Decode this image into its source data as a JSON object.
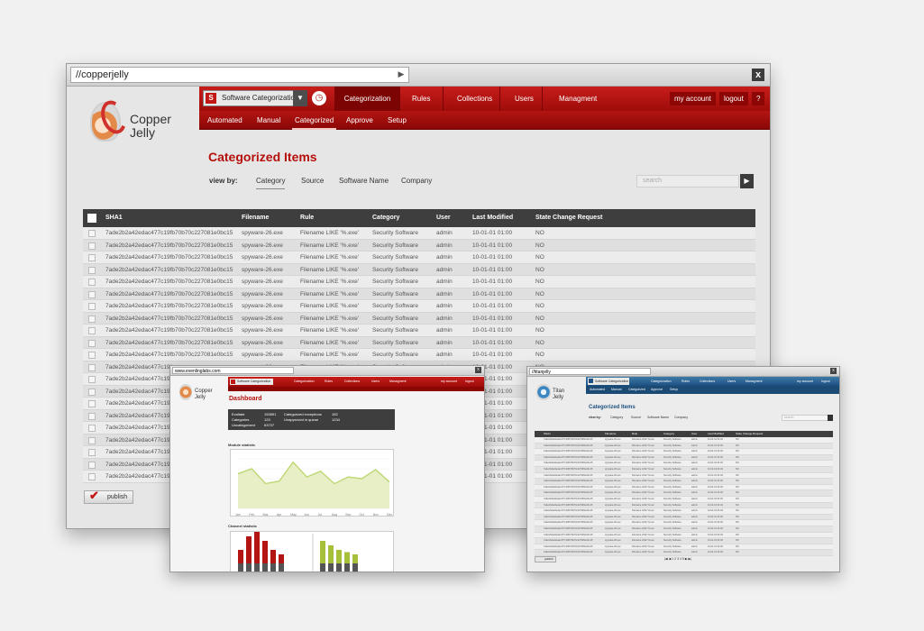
{
  "main_window": {
    "url": "//copperjelly",
    "go": "▶",
    "close": "x",
    "logo": {
      "line1": "Copper",
      "line2": "Jelly"
    },
    "software_select": {
      "badge": "S",
      "label": "Software Categorization",
      "arrow": "▼"
    },
    "history_icon": "◷",
    "nav_main": [
      "Categorization",
      "Rules",
      "Collections",
      "Users",
      "Managment"
    ],
    "nav_right": [
      "my account",
      "logout",
      "?"
    ],
    "nav_sub": [
      "Automated",
      "Manual",
      "Categorized",
      "Approve",
      "Setup"
    ],
    "page_title": "Categorized Items",
    "view_by_label": "view by:",
    "view_by_options": [
      "Category",
      "Source",
      "Software Name",
      "Company"
    ],
    "search_placeholder": "search",
    "search_go": "▶",
    "table": {
      "headers": [
        "SHA1",
        "Filename",
        "Rule",
        "Category",
        "User",
        "Last Modified",
        "State Change Request"
      ],
      "row": [
        "7ade2b2a42edac477c19fb70b70c227081e0bc15",
        "spyware-26.exe",
        "Filename LIKE '%.exe'",
        "Security Software",
        "admin",
        "10-01-01 01:00",
        "NO"
      ],
      "row_count": 21,
      "partial_sha": "7ade2b2a42edac477c19f"
    },
    "publish_label": "publish",
    "publish_icon": "✔"
  },
  "overlay_dashboard": {
    "url": "www.evenlinglabs.com",
    "close": "x",
    "logo": {
      "line1": "Copper",
      "line2": "Jelly"
    },
    "software_select": "Software Categorization",
    "nav_main": [
      "Categorization",
      "Rules",
      "Collections",
      "Users",
      "Managment"
    ],
    "nav_right": [
      "my account",
      "logout"
    ],
    "title": "Dashboard",
    "stats": [
      {
        "label": "Evaltate",
        "value": "192891"
      },
      {
        "label": "Categories",
        "value": "123"
      },
      {
        "label": "Uncategorized",
        "value": "63737"
      },
      {
        "label": "Categorized exceptions",
        "value": "152"
      },
      {
        "label": "Unapproved in queue",
        "value": "1234"
      }
    ],
    "module_statistic": "Module statistic",
    "channel_statistic": "Channel statistic",
    "months": [
      "Jan",
      "Feb",
      "Mar",
      "Apr",
      "May",
      "Jun",
      "Jul",
      "Aug",
      "Sep",
      "Oct",
      "Nov",
      "Dec"
    ],
    "line_values": [
      42,
      48,
      30,
      33,
      56,
      38,
      45,
      30,
      38,
      36,
      47,
      32
    ],
    "bar_values_red": [
      6,
      12,
      14,
      10,
      6,
      4
    ],
    "bar_values_green": [
      10,
      8,
      6,
      5,
      4
    ],
    "accent": "#c0d878"
  },
  "overlay_titan": {
    "url": "//titanjelly",
    "close": "x",
    "logo": {
      "line1": "Titan",
      "line2": "Jelly"
    },
    "software_select": "Software Categorization",
    "nav_main": [
      "Categorization",
      "Rules",
      "Collections",
      "Users",
      "Managment"
    ],
    "nav_right": [
      "my account",
      "logout"
    ],
    "nav_sub": [
      "Automated",
      "Manual",
      "Categorized",
      "Approve",
      "Setup"
    ],
    "title": "Categorized Items",
    "view_by_label": "view by:",
    "view_by_options": [
      "Category",
      "Source",
      "Software Name",
      "Company"
    ],
    "search_placeholder": "search",
    "headers": [
      "SHA1",
      "Filename",
      "Rule",
      "Category",
      "User",
      "Last Modified",
      "State Change Request"
    ],
    "row": [
      "7ade2b2a42edac477c19fb70b70c227081e0bc15",
      "spyware-26.exe",
      "Filename LIKE '%.exe'",
      "Security Software",
      "admin",
      "10-01-01 01:00",
      "NO"
    ],
    "row_count": 20,
    "publish_label": "publish",
    "pager": "|◀ ◀ 1 2 3 4 5 ▶ ▶|"
  },
  "colors": {
    "copper_red": "#b31512",
    "titan_blue": "#1d5080",
    "dark_header": "#3e3e3e"
  }
}
